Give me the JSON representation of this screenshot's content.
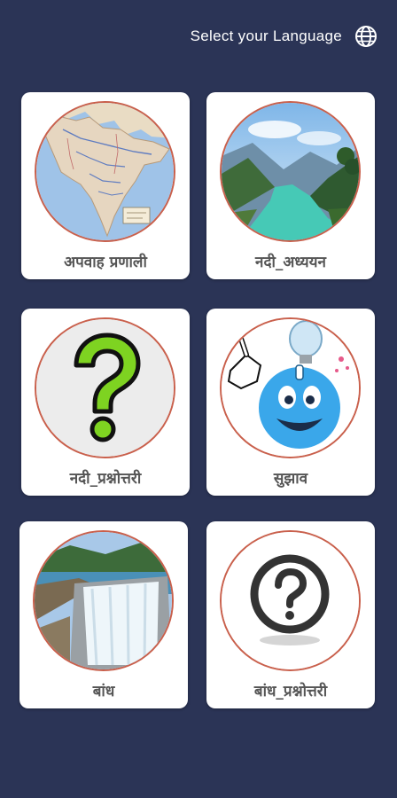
{
  "header": {
    "language_label": "Select your Language",
    "language_icon": "globe-icon"
  },
  "cards": [
    {
      "label": "अपवाह प्रणाली",
      "icon": "india-drainage-map-image"
    },
    {
      "label": "नदी_अध्ययन",
      "icon": "river-valley-image"
    },
    {
      "label": "नदी_प्रश्नोत्तरी",
      "icon": "green-question-mark-image"
    },
    {
      "label": "सुझाव",
      "icon": "idea-bulb-mascot-image"
    },
    {
      "label": "बांध",
      "icon": "dam-waterfall-image"
    },
    {
      "label": "बांध_प्रश्नोत्तरी",
      "icon": "question-circle-icon"
    }
  ]
}
